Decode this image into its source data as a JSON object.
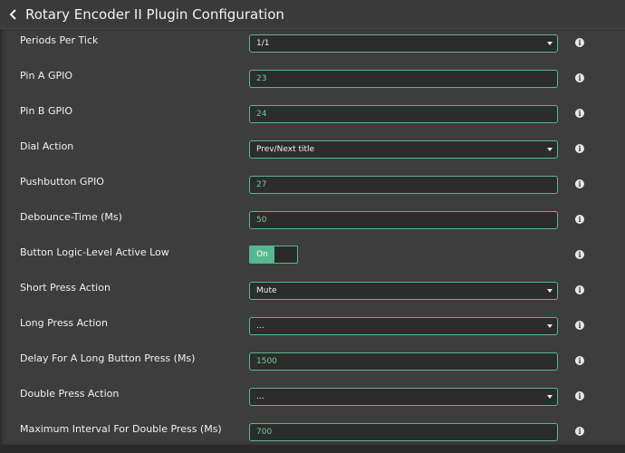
{
  "header": {
    "title": "Rotary Encoder II Plugin Configuration"
  },
  "colors": {
    "accent": "#55b88e",
    "panel": "#3d3d3d",
    "background": "#2a2a2a"
  },
  "rows": [
    {
      "label": "Periods Per Tick",
      "type": "select",
      "value": "1/1"
    },
    {
      "label": "Pin A GPIO",
      "type": "input",
      "value": "23"
    },
    {
      "label": "Pin B GPIO",
      "type": "input",
      "value": "24"
    },
    {
      "label": "Dial Action",
      "type": "select",
      "value": "Prev/Next title"
    },
    {
      "label": "Pushbutton GPIO",
      "type": "input",
      "value": "27"
    },
    {
      "label": "Debounce-Time (Ms)",
      "type": "input",
      "value": "50"
    },
    {
      "label": "Button Logic-Level Active Low",
      "type": "toggle",
      "value": "On"
    },
    {
      "label": "Short Press Action",
      "type": "select",
      "value": "Mute"
    },
    {
      "label": "Long Press Action",
      "type": "select",
      "value": "..."
    },
    {
      "label": "Delay For A Long Button Press (Ms)",
      "type": "input",
      "value": "1500"
    },
    {
      "label": "Double Press Action",
      "type": "select",
      "value": "..."
    },
    {
      "label": "Maximum Interval For Double Press (Ms)",
      "type": "input",
      "value": "700"
    }
  ],
  "info_symbol": "i"
}
